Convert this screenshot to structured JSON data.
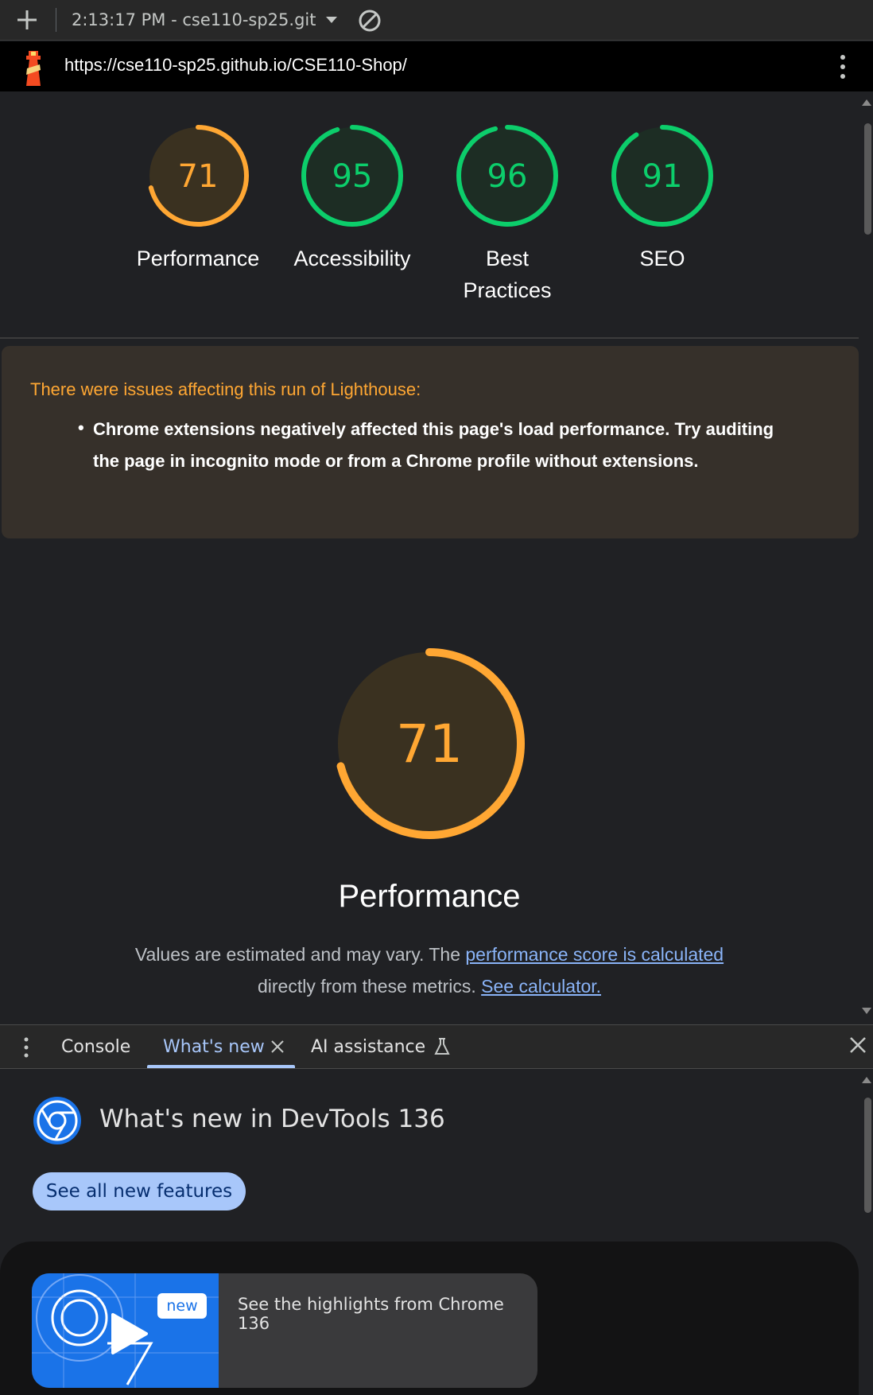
{
  "toolbar": {
    "run_label": "2:13:17 PM - cse110-sp25.git"
  },
  "urlbar": {
    "url": "https://cse110-sp25.github.io/CSE110-Shop/"
  },
  "categories": [
    {
      "score": "71",
      "value": 0.71,
      "label": "Performance",
      "color": "#ffa733",
      "fill": "#3a3120"
    },
    {
      "score": "95",
      "value": 0.95,
      "label": "Accessibility",
      "color": "#0cce6b",
      "fill": "#1d2d24"
    },
    {
      "score": "96",
      "value": 0.96,
      "label": "Best Practices",
      "color": "#0cce6b",
      "fill": "#1d2d24"
    },
    {
      "score": "91",
      "value": 0.91,
      "label": "SEO",
      "color": "#0cce6b",
      "fill": "#1d2d24"
    }
  ],
  "warning": {
    "title": "There were issues affecting this run of Lighthouse:",
    "items": [
      "Chrome extensions negatively affected this page's load performance. Try auditing the page in incognito mode or from a Chrome profile without extensions."
    ]
  },
  "performance": {
    "score": "71",
    "value": 0.71,
    "title": "Performance",
    "desc_prefix": "Values are estimated and may vary. The ",
    "desc_link1": "performance score is calculated",
    "desc_middle": " directly from these metrics. ",
    "desc_link2": "See calculator."
  },
  "drawer": {
    "tabs": [
      {
        "label": "Console",
        "active": false
      },
      {
        "label": "What's new",
        "active": true
      },
      {
        "label": "AI assistance",
        "active": false
      }
    ]
  },
  "whats_new": {
    "title": "What's new in DevTools 136",
    "button": "See all new features",
    "card_badge": "new",
    "card_text": "See the highlights from Chrome 136"
  },
  "colors": {
    "orange": "#ffa733",
    "green": "#0cce6b",
    "link": "#8ab4f8",
    "accent": "#a8c7fa"
  },
  "icons": [
    "plus-icon",
    "dropdown-arrow-icon",
    "block-icon",
    "lighthouse-icon",
    "kebab-icon",
    "close-icon",
    "flask-icon",
    "chrome-logo-icon",
    "play-icon"
  ]
}
